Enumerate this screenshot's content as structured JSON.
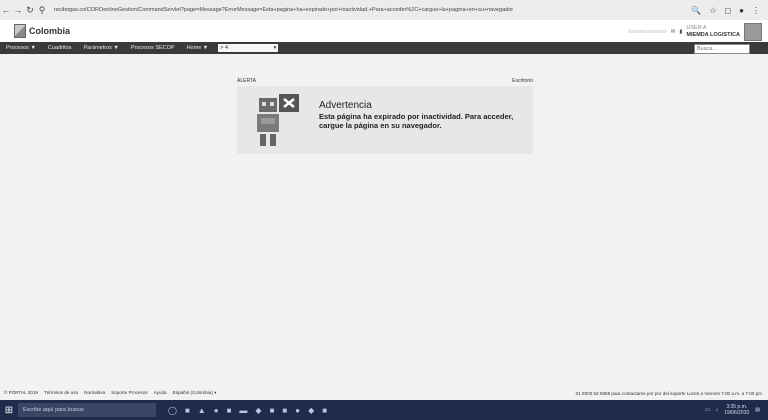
{
  "browser": {
    "url": "recibogas.co/COROenlineGestion/CommandServlet?page=Message?ErrorMessage=Esta+pagina+ha+expirado+por+inactividad.+Para+acceder%2C+cargue+la+pagina+en+su+navegador"
  },
  "header": {
    "logo_text": "Colombia",
    "blurred_info": "xxxxxxxxxxxxxx",
    "user_name": "USER A",
    "user_company": "MIEMDA LOGISTICA"
  },
  "menu": {
    "items": [
      "Procesos ▼",
      "Cuadritos",
      "Parámetros ▼",
      "Procesos SECOP",
      "Home ▼"
    ],
    "select_value": "> 4",
    "search_placeholder": "Busca..."
  },
  "alert": {
    "label": "ALERTA",
    "link": "Escritorio",
    "title": "Advertencia",
    "message": "Esta página ha expirado por inactividad. Para acceder, cargue la página en su navegador."
  },
  "footer": {
    "links": [
      "© PORTAL 2019",
      "Términos de uso",
      "Normativa",
      "Soporte Procesos",
      "Ayuda",
      "Español (Colombia) ▾"
    ],
    "contact": "01 8000 52 5858 para contactarse por por del soporte  Lunes a Viernes 7:00 a.m. a 7:00 pm"
  },
  "taskbar": {
    "search_placeholder": "Escribe aquí para buscar",
    "time": "3:35 p.m.",
    "date": "19/06/2020"
  },
  "colors": {
    "menubar": "#3a3a3a",
    "taskbar": "#1f2b4b",
    "alert_bg": "#e7e7e7"
  }
}
